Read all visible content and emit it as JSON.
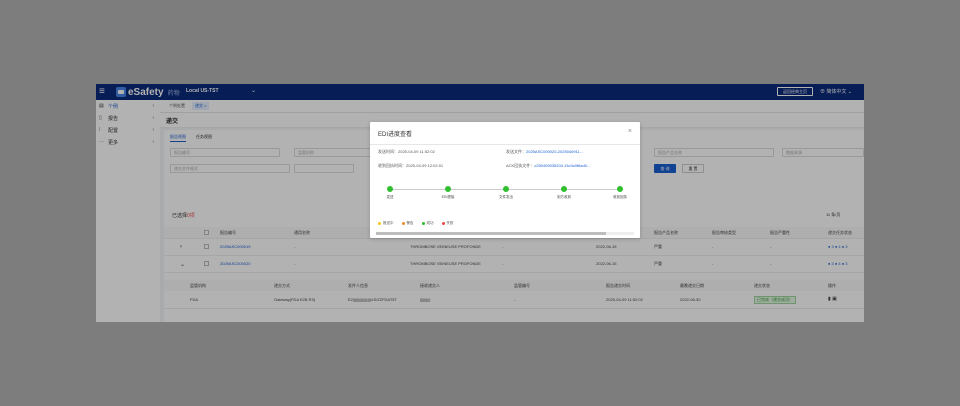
{
  "topbar": {
    "brand": "eSafety",
    "brand_sub": "药物",
    "env": "Local US-TST",
    "caret": "⌄",
    "action_btn": "返回经典主页",
    "lang": "⊕ 简体中文 ⌄",
    "menu_icon": "≡"
  },
  "sidebar": {
    "items": [
      {
        "icon": "▤",
        "label": "个例",
        "arrow": "›",
        "active": true
      },
      {
        "icon": "▯",
        "label": "报告",
        "arrow": "›"
      },
      {
        "icon": "⁞",
        "label": "配置",
        "arrow": "›"
      },
      {
        "icon": "⋯",
        "label": "更多",
        "arrow": "›"
      }
    ]
  },
  "page_tabs": [
    "个例处置",
    "递交 ×"
  ],
  "page_title": "递交",
  "subtabs": [
    "报告视图",
    "任务视图"
  ],
  "filters": {
    "f1": "报告编号",
    "f2": "监管机构",
    "f3": "递交文件格式",
    "f4": "报告产品名称",
    "f5": "数据来源"
  },
  "buttons": {
    "search": "查 询",
    "reset": "重 置"
  },
  "selected": {
    "prefix": "已选择",
    "count": "0项"
  },
  "total": "11 条/页",
  "table": {
    "headers": [
      "报告编号",
      "通用名称",
      "",
      "",
      "报告产品名称",
      "报告审核类型",
      "报告严重性",
      "递交任务状态"
    ],
    "rows": [
      {
        "expand": "›",
        "id": "2025ASC000019",
        "generic": "-",
        "event": "THROMBOSE VEINEUSE PROFONDE",
        "dash": "-",
        "date": "2022-06-15",
        "serious": "严重",
        "a": "-",
        "b": "-",
        "status": "● 3 ● 4 ● 3"
      },
      {
        "expand": "⌄",
        "id": "2025ASC000020",
        "generic": "-",
        "event": "THROMBOSE VEINEUSE PROFONDE",
        "dash": "-",
        "date": "2022-06-15",
        "serious": "严重",
        "a": "-",
        "b": "-",
        "status": "● 3 ● 4 ● 3"
      }
    ],
    "sub_headers": [
      "监管机构",
      "递交方式",
      "发件人信息",
      "接收递交人",
      "监管编号",
      "报告递交时间",
      "最晚递交日期",
      "递交状态",
      "操作"
    ],
    "sub_row": {
      "agency": "FDA",
      "method": "Gateway(FDA E2B R3)",
      "sender": "E2|||||||||||||||||US/ZZFDAT5T",
      "receiver": "||||||||||",
      "reg_no": "-",
      "submit_time": "2025-04-09 11:52:02",
      "deadline": "2022-06-30",
      "status": "已完成（递交成功）",
      "ops": "▮ ▣"
    }
  },
  "modal": {
    "title": "EDI进度查看",
    "close": "×",
    "send_time_label": "发送时间：",
    "send_time": "2025-04-09 11:52:02",
    "send_file_label": "发送文件：",
    "send_file": "2025ASC000020-2025040911...",
    "receive_time_label": "收到回执时间：",
    "receive_time": "2025-04-09 12:02:01",
    "ack_file_label": "ACK回执文件：",
    "ack_file": "c250409035204.13c3c0f6ad0...",
    "steps": [
      "发送",
      "EDI提接",
      "文件发出",
      "到方收到",
      "收到回执"
    ],
    "legend": [
      {
        "label": "推送中",
        "color": "#f5c518"
      },
      {
        "label": "警告",
        "color": "#f08c2e"
      },
      {
        "label": "成功",
        "color": "#2fbf2f"
      },
      {
        "label": "失败",
        "color": "#e94b4b"
      }
    ]
  }
}
